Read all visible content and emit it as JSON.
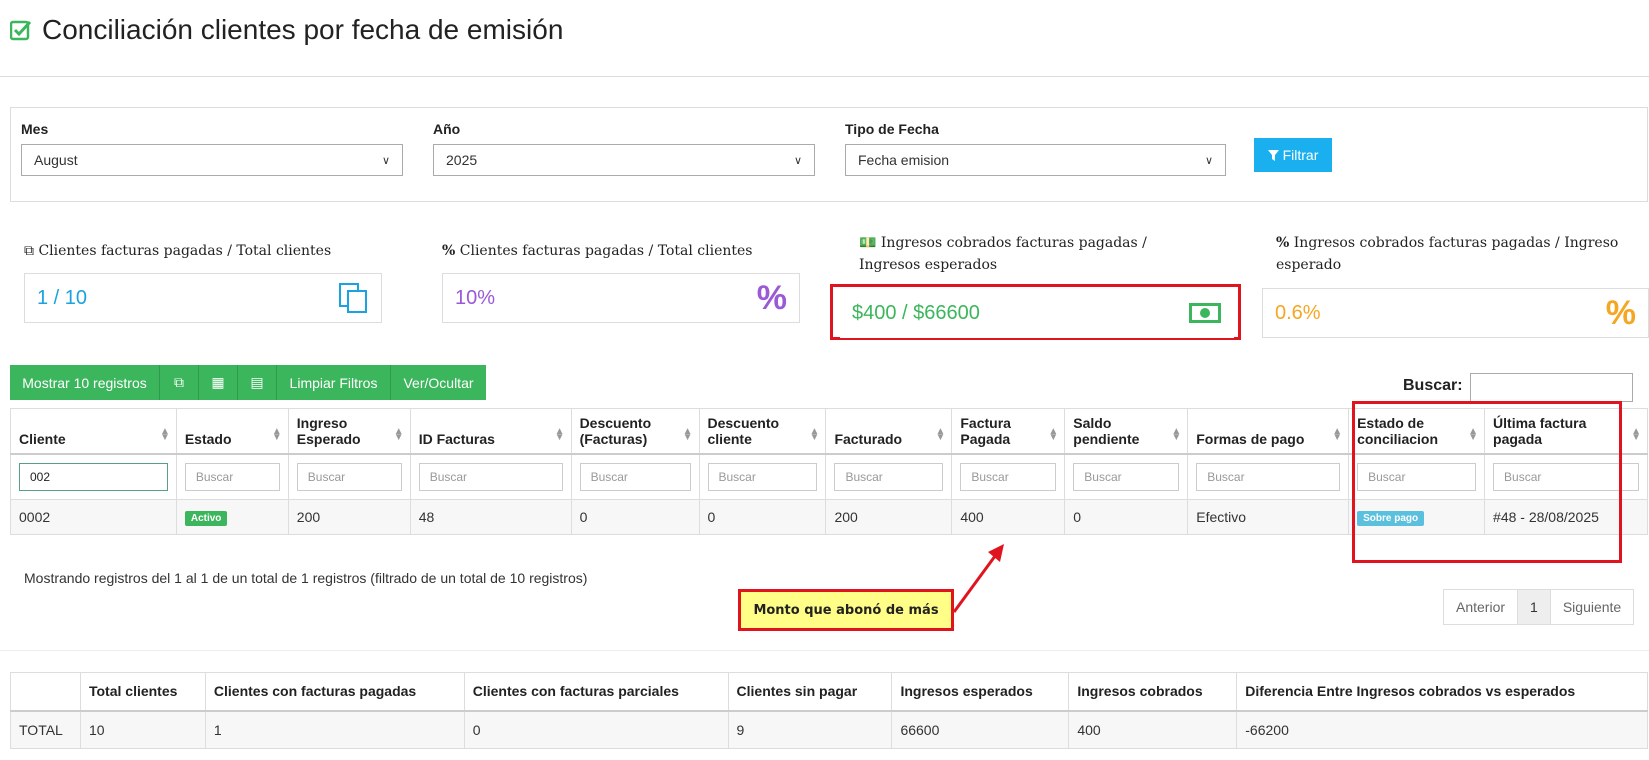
{
  "page": {
    "title": "Conciliación clientes por fecha de emisión"
  },
  "filters": {
    "mes_label": "Mes",
    "mes_value": "August",
    "anio_label": "Año",
    "anio_value": "2025",
    "tipo_label": "Tipo de Fecha",
    "tipo_value": "Fecha emision",
    "filtrar_label": "Filtrar"
  },
  "stats": [
    {
      "title": "Clientes facturas pagadas / Total clientes",
      "value": "1 / 10",
      "color": "#1aa3e0"
    },
    {
      "title": "Clientes facturas pagadas / Total clientes",
      "value": "10%",
      "color": "#9b59d6"
    },
    {
      "title": "Ingresos cobrados facturas pagadas / Ingresos esperados",
      "value": "$400 / $66600",
      "color": "#3cb65c"
    },
    {
      "title": "Ingresos cobrados facturas pagadas / Ingreso esperado",
      "value": "0.6%",
      "color": "#f5a623"
    }
  ],
  "toolbar": {
    "show": "Mostrar 10 registros",
    "clear": "Limpiar Filtros",
    "toggle": "Ver/Ocultar"
  },
  "search": {
    "label": "Buscar:"
  },
  "table": {
    "headers": [
      "Cliente",
      "Estado",
      "Ingreso Esperado",
      "ID Facturas",
      "Descuento (Facturas)",
      "Descuento cliente",
      "Facturado",
      "Factura Pagada",
      "Saldo pendiente",
      "Formas de pago",
      "Estado de conciliacion",
      "Última factura pagada"
    ],
    "search_placeholder": "Buscar",
    "search_cliente_value": "002",
    "row": {
      "cliente": "0002",
      "estado": "Activo",
      "ingreso_esperado": "200",
      "id_facturas": "48",
      "descuento_facturas": "0",
      "descuento_cliente": "0",
      "facturado": "200",
      "factura_pagada": "400",
      "saldo_pendiente": "0",
      "formas_pago": "Efectivo",
      "estado_conciliacion": "Sobre pago",
      "ultima_factura": "#48 - 28/08/2025"
    },
    "info": "Mostrando registros del 1 al 1 de un total de 1 registros (filtrado de un total de 10 registros)"
  },
  "pager": {
    "prev": "Anterior",
    "page": "1",
    "next": "Siguiente"
  },
  "callout": "Monto que abonó de más",
  "totals": {
    "headers": [
      "",
      "Total clientes",
      "Clientes con facturas pagadas",
      "Clientes con facturas parciales",
      "Clientes sin pagar",
      "Ingresos esperados",
      "Ingresos cobrados",
      "Diferencia Entre Ingresos cobrados vs esperados"
    ],
    "row": [
      "TOTAL",
      "10",
      "1",
      "0",
      "9",
      "66600",
      "400",
      "-66200"
    ]
  },
  "colors": {
    "green": "#3cb65c",
    "blue": "#1ab0f0",
    "red_annotation": "#e0141e",
    "badge_active": "#3cb65c",
    "badge_overpay": "#5bc0de"
  }
}
